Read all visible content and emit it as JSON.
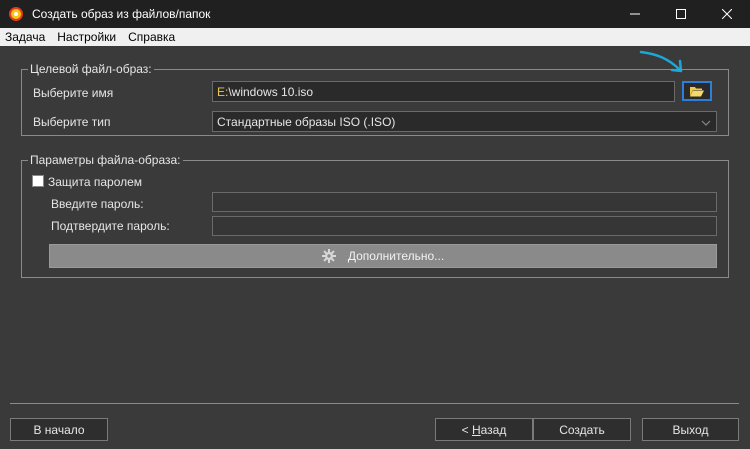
{
  "window": {
    "title": "Создать образ из файлов/папок",
    "minimize": "—",
    "maximize": "☐",
    "close": "✕"
  },
  "menu": [
    "Задача",
    "Настройки",
    "Справка"
  ],
  "target_group": {
    "legend": "Целевой файл-образ:",
    "name_label": "Выберите имя",
    "name_value_drive": "E:",
    "name_value_path": "\\windows 10.iso",
    "type_label": "Выберите тип",
    "type_value": "Стандартные образы ISO (.ISO)"
  },
  "params_group": {
    "legend": "Параметры файла-образа:",
    "password_protect": "Защита паролем",
    "password_checked": false,
    "enter_password": "Введите пароль:",
    "confirm_password": "Подтвердите пароль:",
    "advanced": "Дополнительно..."
  },
  "buttons": {
    "start": "В начало",
    "back_prefix": "< ",
    "back_accel": "Н",
    "back_rest": "азад",
    "create": "Создать",
    "exit": "Выход"
  },
  "colors": {
    "accent_border": "#2f7fd8",
    "drive_letter": "#e8c84a",
    "annotation_arrow": "#1fa6d6"
  }
}
